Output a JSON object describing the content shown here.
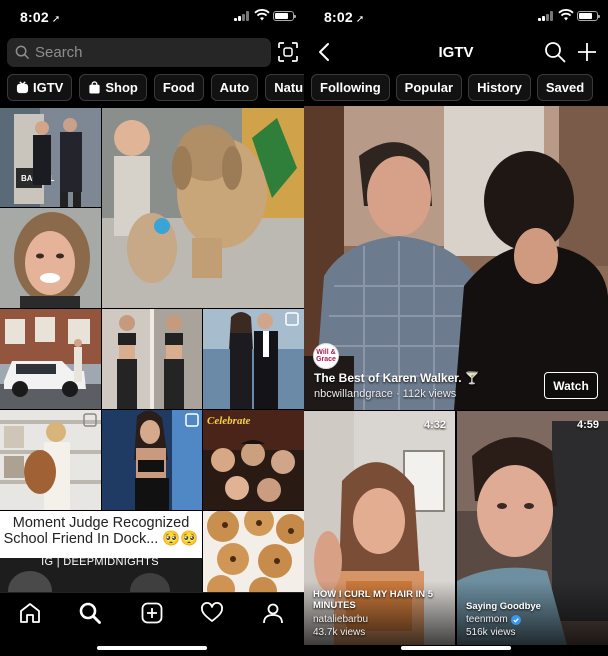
{
  "left": {
    "status": {
      "time": "8:02"
    },
    "search": {
      "placeholder": "Search"
    },
    "chips": [
      {
        "label": "IGTV",
        "icon": "igtv-icon"
      },
      {
        "label": "Shop",
        "icon": "shop-bag-icon"
      },
      {
        "label": "Food"
      },
      {
        "label": "Auto"
      },
      {
        "label": "Nature"
      }
    ],
    "grid": {
      "tile_texts": {
        "bachelor": "BACHEL",
        "celebrate": "Celebrate"
      },
      "meme_caption": "Moment Judge Recognized School Friend In Dock... 🥺🥺",
      "meme_credit": "IG | DEEPMIDNIGHTS"
    },
    "tabbar": [
      "home-icon",
      "search-icon",
      "add-post-icon",
      "heart-icon",
      "profile-icon"
    ]
  },
  "right": {
    "status": {
      "time": "8:02"
    },
    "header": {
      "title": "IGTV"
    },
    "tabs": [
      "Following",
      "Popular",
      "History",
      "Saved"
    ],
    "featured": {
      "logo_text": "Will & Grace",
      "title": "The Best of Karen Walker. 🍸",
      "channel": "nbcwillandgrace",
      "views": "112k views",
      "watch_label": "Watch"
    },
    "cards": [
      {
        "duration": "4:32",
        "title": "HOW I CURL MY HAIR IN 5 MINUTES",
        "channel": "nataliebarbu",
        "views": "43.7k views"
      },
      {
        "duration": "4:59",
        "title": "Saying Goodbye",
        "channel": "teenmom",
        "views": "516k views",
        "verified": true
      }
    ]
  },
  "colors": {
    "background": "#000000",
    "chip_bg": "#121212",
    "chip_border": "#3a3a3a",
    "search_bg": "#262626",
    "placeholder": "#8e8e8e",
    "verified": "#3897f0"
  }
}
